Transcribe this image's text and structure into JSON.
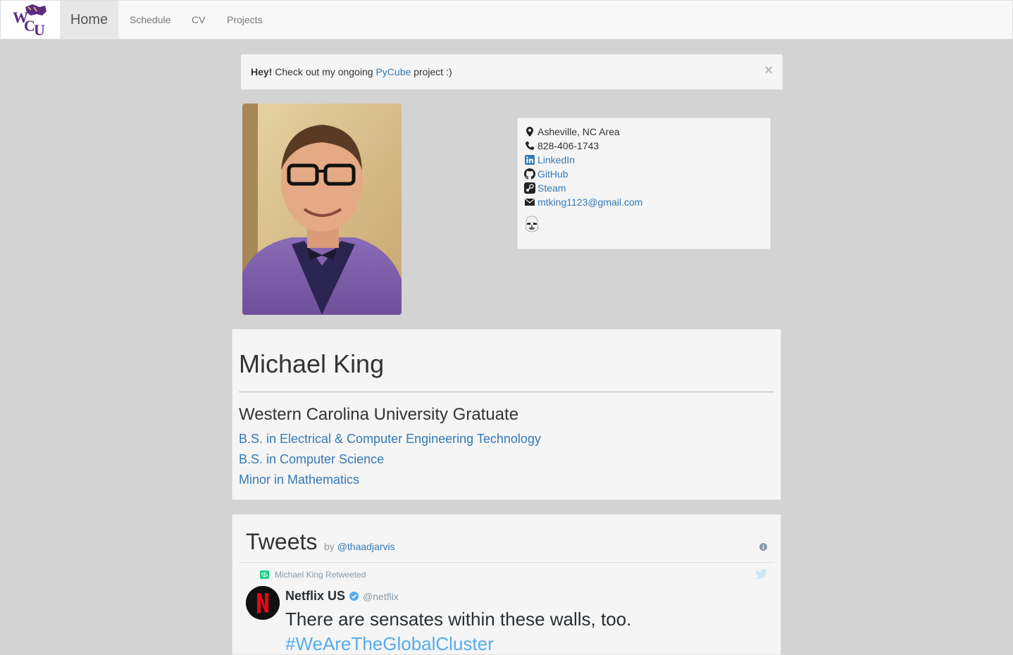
{
  "nav": {
    "home": "Home",
    "links": [
      "Schedule",
      "CV",
      "Projects"
    ]
  },
  "alert": {
    "lead": "Hey!",
    "text_before": "Check out my ongoing",
    "link": "PyCube",
    "text_after": "project :)",
    "close": "×"
  },
  "contact": {
    "location": "Asheville, NC Area",
    "phone": "828-406-1743",
    "linkedin": "LinkedIn",
    "github": "GitHub",
    "steam": "Steam",
    "email": "mtking1123@gmail.com"
  },
  "bio": {
    "name": "Michael King",
    "graduate": "Western Carolina University Gratuate",
    "degrees": [
      "B.S. in Electrical & Computer Engineering Technology",
      "B.S. in Computer Science",
      "Minor in Mathematics"
    ]
  },
  "tweets": {
    "title": "Tweets",
    "by": "by",
    "handle": "@thaadjarvis",
    "retweet_label": "Michael King Retweeted",
    "author_name": "Netflix US",
    "author_handle": "@netflix",
    "text": "There are sensates within these walls, too.",
    "hashtag": "#WeAreTheGlobalCluster"
  },
  "colors": {
    "link": "#337ab7",
    "background": "#d3d3d3",
    "panel": "#f5f5f5",
    "twitter": "#55acee",
    "retweet": "#19cf86",
    "netflix_red": "#e50914"
  }
}
